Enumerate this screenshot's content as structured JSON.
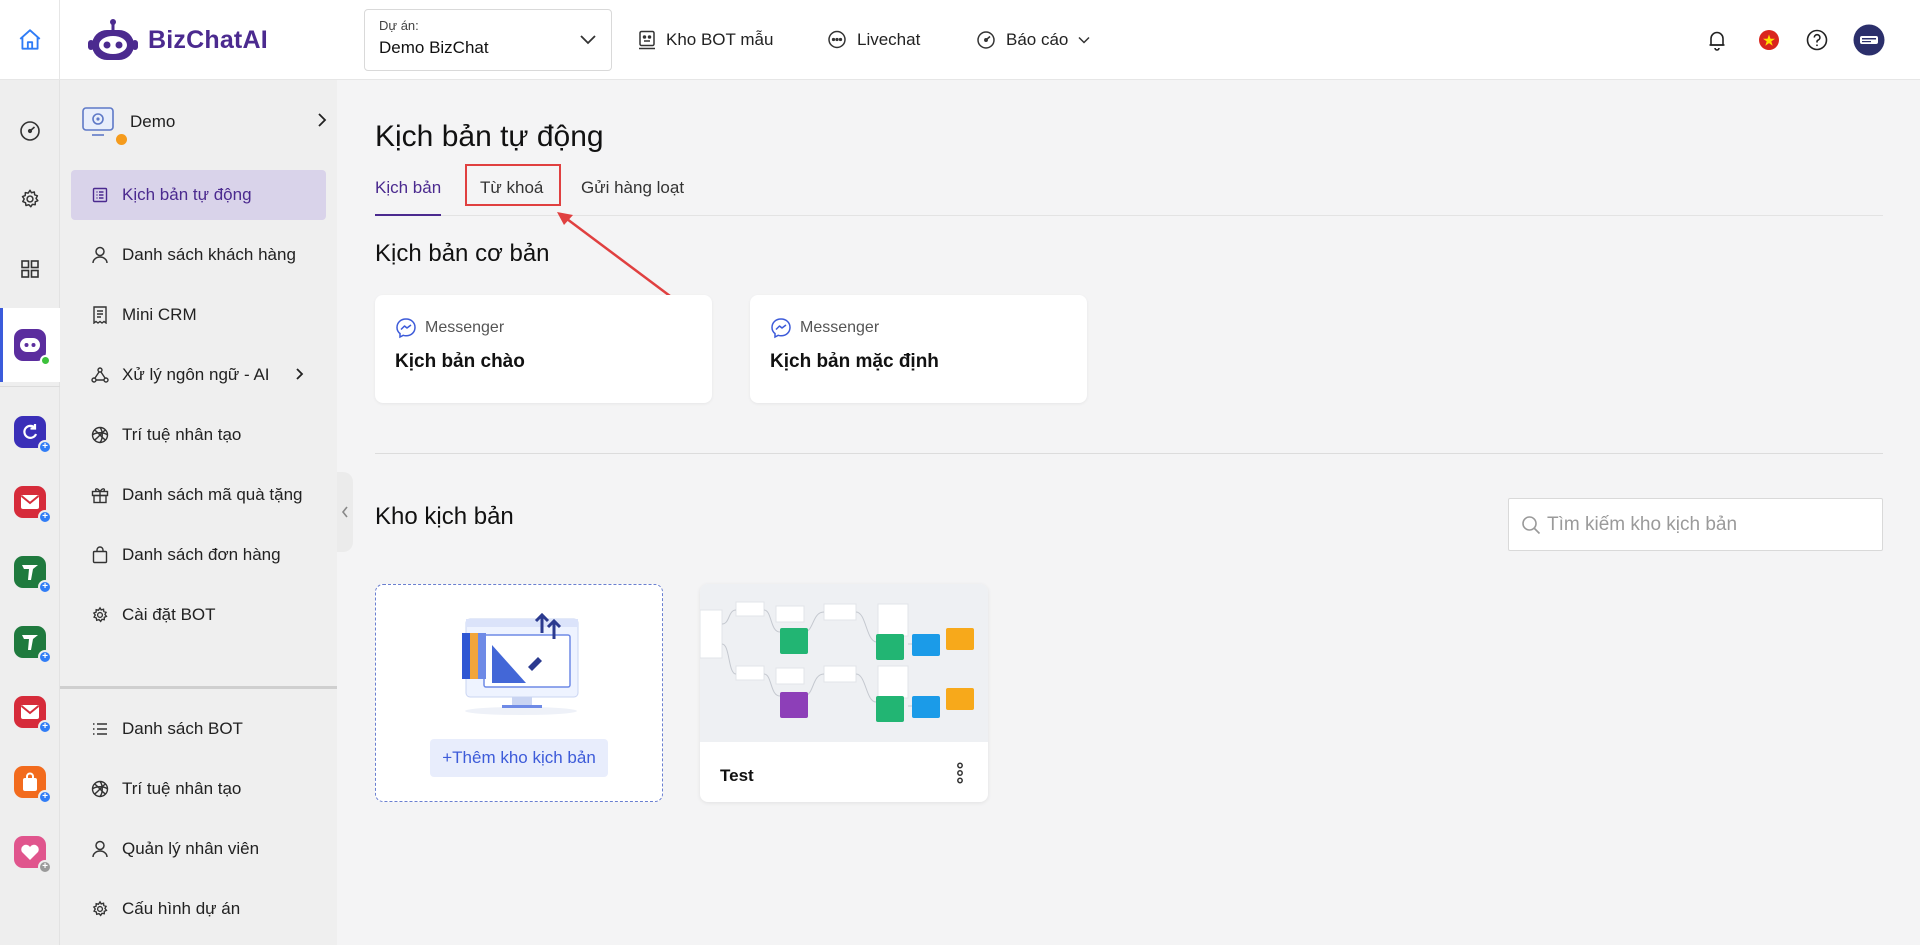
{
  "brand": {
    "name_part1": "BizChat",
    "name_part2": "AI"
  },
  "project": {
    "label": "Dự án:",
    "value": "Demo BizChat"
  },
  "topnav": {
    "bot_templates": "Kho BOT mẫu",
    "livechat": "Livechat",
    "reports": "Báo cáo"
  },
  "sidebar": {
    "bot_name": "Demo",
    "items": [
      {
        "label": "Kịch bản tự động",
        "icon": "list-doc-icon",
        "active": true
      },
      {
        "label": "Danh sách khách hàng",
        "icon": "user-icon"
      },
      {
        "label": "Mini CRM",
        "icon": "receipt-icon"
      },
      {
        "label": "Xử lý ngôn ngữ - AI",
        "icon": "nodes-icon"
      },
      {
        "label": "Trí tuệ nhân tạo",
        "icon": "ai-swirl-icon"
      },
      {
        "label": "Danh sách mã quà tặng",
        "icon": "gift-icon"
      },
      {
        "label": "Danh sách đơn hàng",
        "icon": "bag-icon"
      },
      {
        "label": "Cài đặt BOT",
        "icon": "gear-icon"
      }
    ],
    "bottom_items": [
      {
        "label": "Danh sách BOT",
        "icon": "list-icon"
      },
      {
        "label": "Trí tuệ nhân tạo",
        "icon": "ai-swirl-icon"
      },
      {
        "label": "Quản lý nhân viên",
        "icon": "user-icon"
      },
      {
        "label": "Cấu hình dự án",
        "icon": "gear-icon"
      }
    ]
  },
  "main": {
    "title": "Kịch bản tự động",
    "tabs": [
      "Kịch bản",
      "Từ khoá",
      "Gửi hàng loạt"
    ],
    "basic_section_title": "Kịch bản cơ bản",
    "basic_cards": [
      {
        "channel": "Messenger",
        "name": "Kịch bản chào"
      },
      {
        "channel": "Messenger",
        "name": "Kịch bản mặc định"
      }
    ],
    "library_title": "Kho kịch bản",
    "search_placeholder": "Tìm kiếm kho kịch bản",
    "add_label": "+Thêm kho kịch bản",
    "templates": [
      {
        "name": "Test"
      }
    ]
  },
  "colors": {
    "brand_purple": "#4b2a8f",
    "active_bg": "#d9d3ea",
    "accent_blue": "#3d5bd9",
    "annotation_red": "#e04040"
  }
}
